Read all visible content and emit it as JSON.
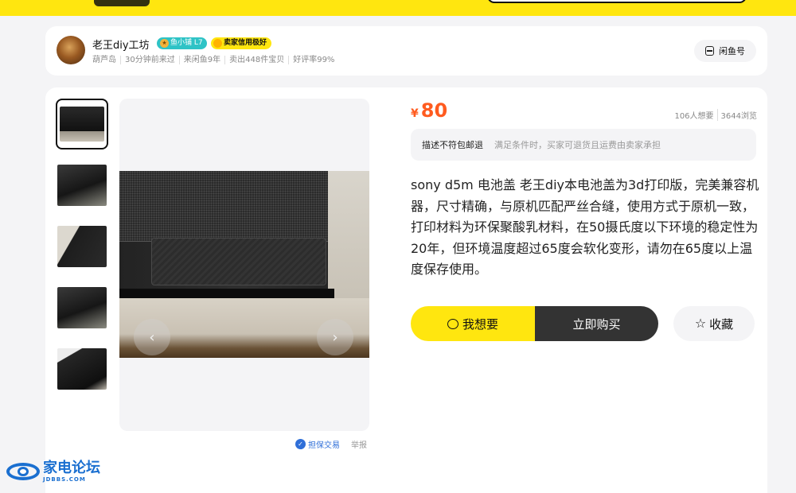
{
  "seller": {
    "name": "老王diy工坊",
    "level_badge": "鱼小铺 L7",
    "credit_badge": "卖家信用极好",
    "meta": [
      "葫芦岛",
      "30分钟前来过",
      "来闲鱼9年",
      "卖出448件宝贝",
      "好评率99%"
    ],
    "xianyu_label": "闲鱼号"
  },
  "product": {
    "currency": "¥",
    "price": "80",
    "wants": "106人想要",
    "views": "3644浏览",
    "policy_title": "描述不符包邮退",
    "policy_desc": "满足条件时，买家可退货且运费由卖家承担",
    "description": "sony d5m 电池盖 老王diy本电池盖为3d打印版，完美兼容机器，尺寸精确，与原机匹配严丝合缝，使用方式于原机一致，打印材料为环保聚酸乳材料，在50摄氏度以下环境的稳定性为20年，但环境温度超过65度会软化变形，请勿在65度以上温度保存使用。"
  },
  "gallery": {
    "thumb_count": 5,
    "active_index": 0,
    "prev_label": "‹",
    "next_label": "›",
    "escrow_label": "担保交易",
    "report_label": "举报"
  },
  "actions": {
    "want_label": "我想要",
    "buy_label": "立即购买",
    "fav_label": "收藏"
  },
  "watermark": {
    "name": "家电论坛",
    "domain": "JDBBS.COM"
  },
  "colors": {
    "brand_yellow": "#ffe60f",
    "price_orange": "#ff5b1f",
    "buy_dark": "#333333",
    "escrow_blue": "#2f6fd8"
  }
}
